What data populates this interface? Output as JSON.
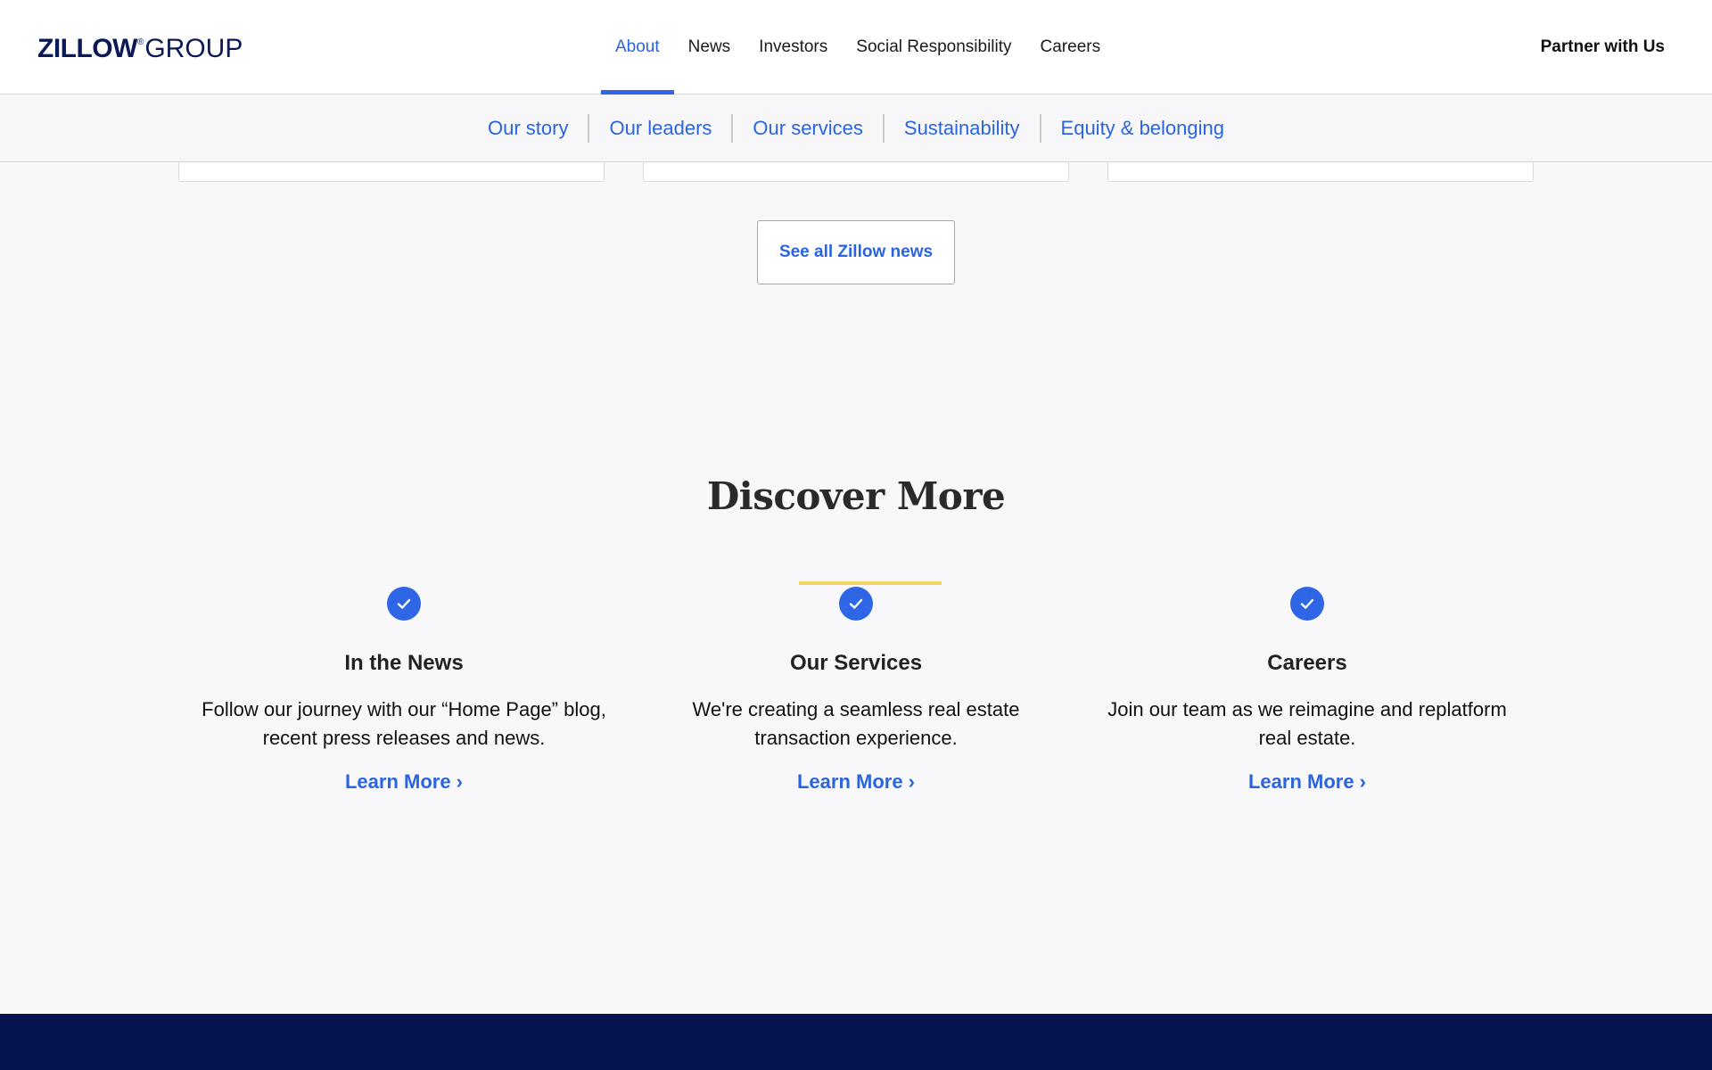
{
  "header": {
    "logo_main": "ZILLOW",
    "logo_reg": "®",
    "logo_suffix": "GROUP",
    "nav": [
      {
        "label": "About",
        "active": true
      },
      {
        "label": "News"
      },
      {
        "label": "Investors"
      },
      {
        "label": "Social Responsibility"
      },
      {
        "label": "Careers"
      }
    ],
    "partner_label": "Partner with Us"
  },
  "subnav": {
    "items": [
      "Our story",
      "Our leaders",
      "Our services",
      "Sustainability",
      "Equity & belonging"
    ]
  },
  "news": {
    "see_all_label": "See all Zillow news"
  },
  "discover": {
    "title": "Discover More",
    "features": [
      {
        "icon": "check-circle-icon",
        "title": "In the News",
        "description": "Follow our journey with our “Home Page” blog, recent press releases and news.",
        "link": "Learn More ›"
      },
      {
        "icon": "check-circle-icon",
        "title": "Our Services",
        "description": "We're creating a seamless real estate transaction experience.",
        "link": "Learn More ›",
        "highlighted": true
      },
      {
        "icon": "check-circle-icon",
        "title": "Careers",
        "description": "Join our team as we reimagine and replatform real estate.",
        "link": "Learn More ›"
      }
    ]
  },
  "colors": {
    "accent_blue": "#2f66e5",
    "link_blue": "#2a64e0",
    "highlight_yellow": "#f2d363",
    "footer_navy": "#06144f"
  }
}
